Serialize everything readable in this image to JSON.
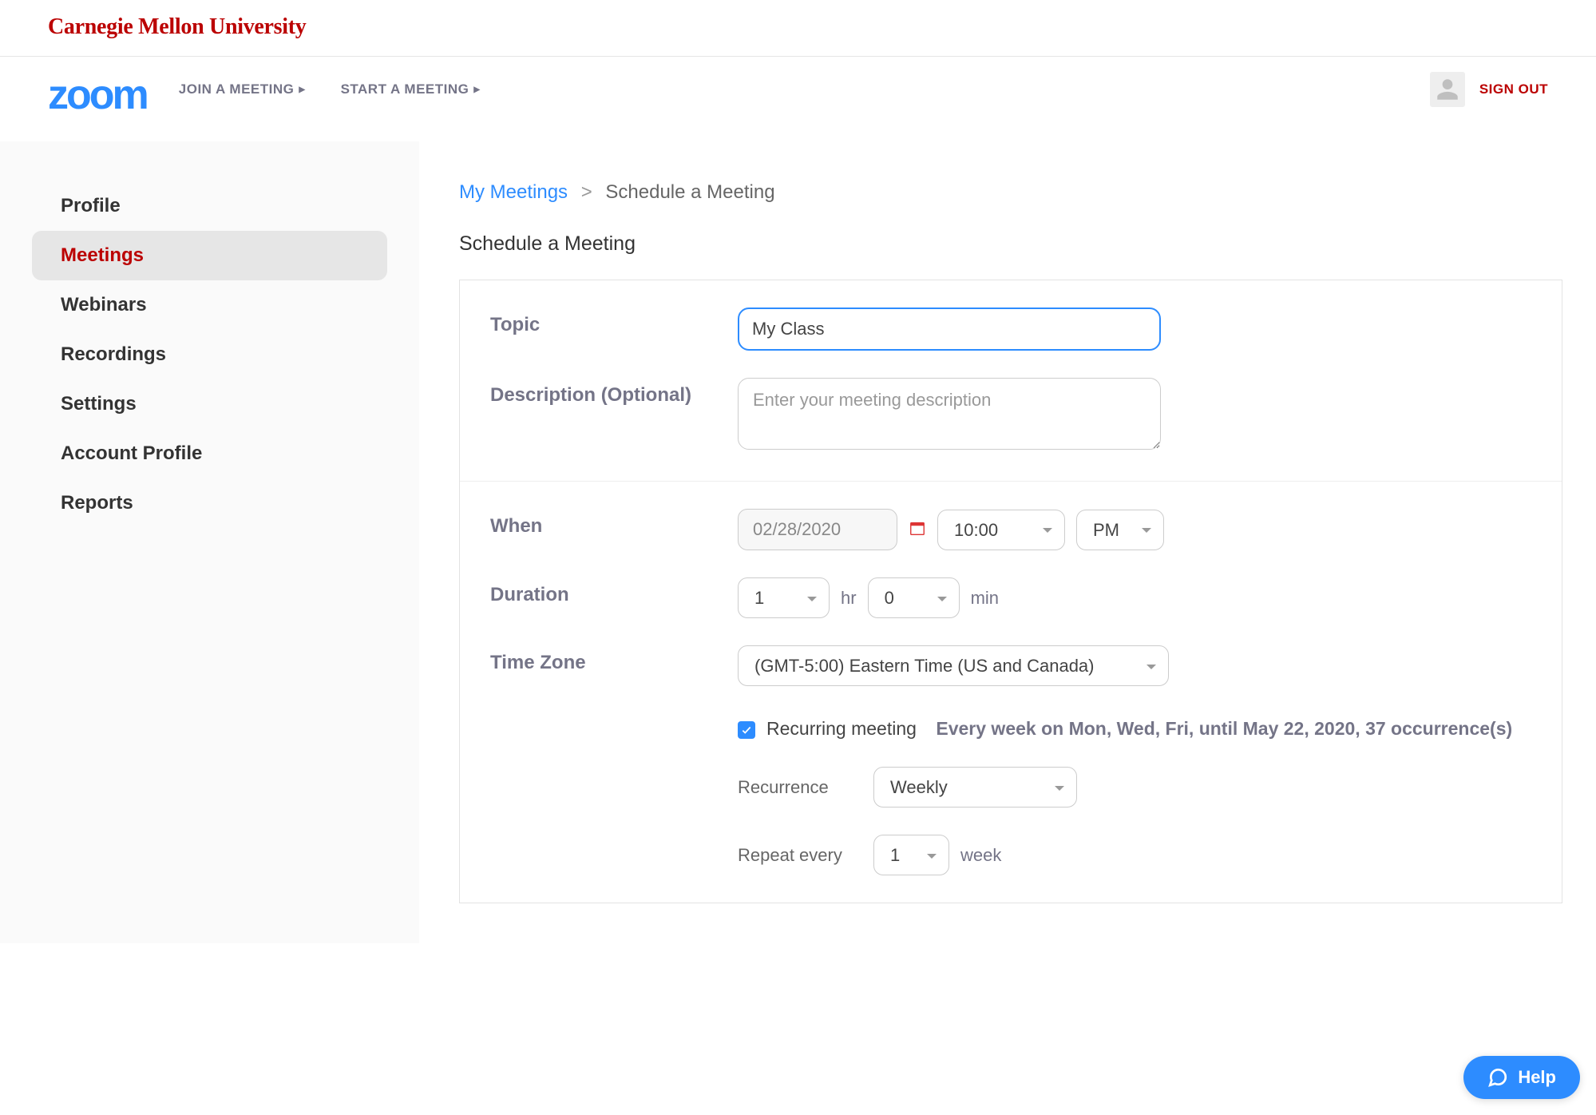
{
  "banner": {
    "university": "Carnegie Mellon University"
  },
  "header": {
    "logo": "zoom",
    "nav": {
      "join": "JOIN A MEETING",
      "start": "START A MEETING"
    },
    "sign_out": "SIGN OUT"
  },
  "sidebar": {
    "items": [
      {
        "label": "Profile",
        "active": false
      },
      {
        "label": "Meetings",
        "active": true
      },
      {
        "label": "Webinars",
        "active": false
      },
      {
        "label": "Recordings",
        "active": false
      },
      {
        "label": "Settings",
        "active": false
      },
      {
        "label": "Account Profile",
        "active": false
      },
      {
        "label": "Reports",
        "active": false
      }
    ]
  },
  "breadcrumb": {
    "parent": "My Meetings",
    "separator": ">",
    "current": "Schedule a Meeting"
  },
  "page_title": "Schedule a Meeting",
  "form": {
    "topic": {
      "label": "Topic",
      "value": "My Class"
    },
    "description": {
      "label": "Description (Optional)",
      "placeholder": "Enter your meeting description"
    },
    "when": {
      "label": "When",
      "date": "02/28/2020",
      "time": "10:00",
      "ampm": "PM"
    },
    "duration": {
      "label": "Duration",
      "hours": "1",
      "hours_unit": "hr",
      "minutes": "0",
      "minutes_unit": "min"
    },
    "timezone": {
      "label": "Time Zone",
      "value": "(GMT-5:00) Eastern Time (US and Canada)"
    },
    "recurring": {
      "checked": true,
      "label": "Recurring meeting",
      "summary": "Every week on Mon, Wed, Fri, until May 22, 2020, 37 occurrence(s)",
      "recurrence_label": "Recurrence",
      "recurrence_value": "Weekly",
      "repeat_label": "Repeat every",
      "repeat_value": "1",
      "repeat_unit": "week"
    }
  },
  "help": {
    "label": "Help"
  }
}
